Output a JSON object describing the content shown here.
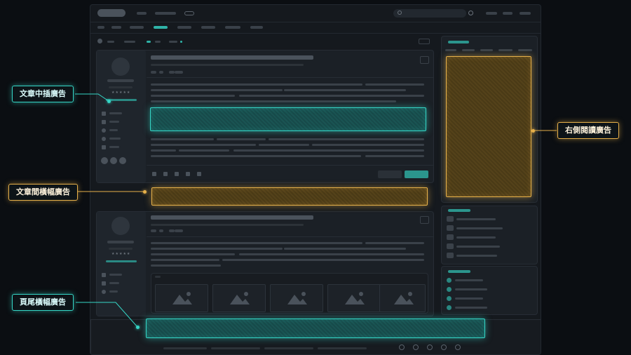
{
  "labels": {
    "in_article": "文章中插廣告",
    "between_articles": "文章間橫幅廣告",
    "sidebar": "右側閱讀廣告",
    "footer": "頁尾橫幅廣告"
  },
  "colors": {
    "teal": "#35d6c6",
    "gold": "#e6b04a",
    "background": "#0b0e12"
  },
  "icons": [
    "search-icon",
    "info-icon",
    "more-icon",
    "calendar-icon",
    "chart-icon",
    "location-icon",
    "tag-icon",
    "like-icon",
    "star-icon",
    "share-icon",
    "comment-icon",
    "flag-icon",
    "image-icon",
    "chevron-right-icon"
  ]
}
